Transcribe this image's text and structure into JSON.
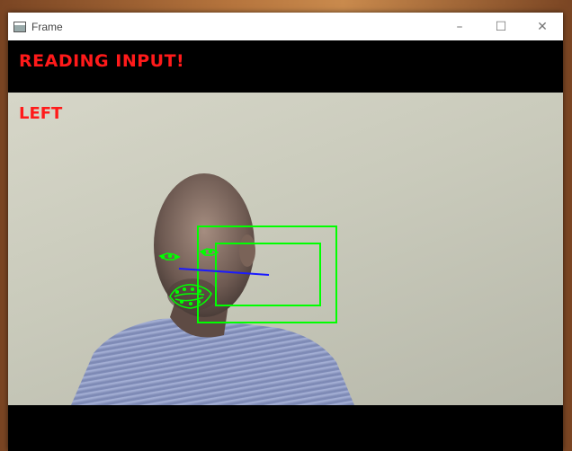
{
  "window": {
    "title": "Frame",
    "controls": {
      "minimize_icon": "minimize-icon",
      "maximize_icon": "maximize-icon",
      "close_icon": "close-icon"
    }
  },
  "overlay": {
    "status": "READING INPUT!",
    "direction": "LEFT"
  },
  "colors": {
    "overlay_text": "#ff1a1a",
    "detection_box": "#00ff00",
    "gaze_line": "#1a1aff",
    "landmarks": "#00ff00"
  }
}
